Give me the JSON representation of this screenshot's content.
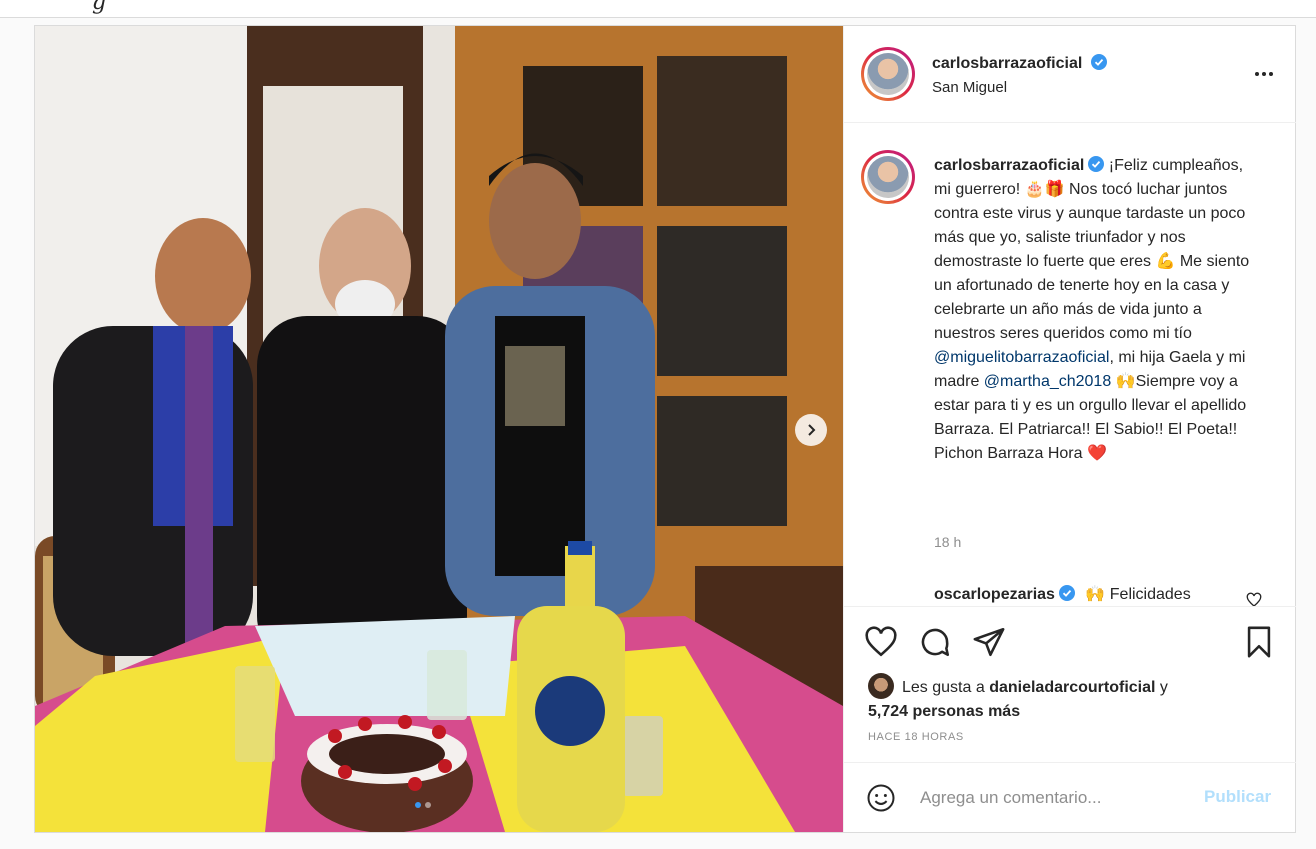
{
  "post": {
    "author": "carlosbarrazaoficial",
    "location": "San Miguel",
    "caption": {
      "part1": "¡Feliz cumpleaños, mi guerrero! 🎂🎁 Nos tocó luchar juntos contra este virus y aunque tardaste un poco más que yo, saliste triunfador y nos demostraste lo fuerte que eres 💪 Me siento un afortunado de tenerte hoy en la casa y celebrarte un año más de vida junto a nuestros seres queridos como mi tío ",
      "mention1": "@miguelitobarrazaoficial",
      "part2": ", mi hija Gaela y mi madre ",
      "mention2": "@martha_ch2018",
      "part3": " 🙌Siempre voy a estar para ti y es un orgullo llevar el apellido Barraza. El Patriarca!! El Sabio!! El Poeta!! Pichon Barraza Hora ❤️"
    },
    "caption_time": "18 h",
    "comment": {
      "user": "oscarlopezarias",
      "text": "🙌 Felicidades"
    },
    "likes": {
      "prefix": "Les gusta a",
      "liker": "danieladarcourtoficial",
      "connector": "y",
      "others": "5,724 personas más"
    },
    "time_ago": "HACE 18 HORAS",
    "comment_box": {
      "placeholder": "Agrega un comentario...",
      "publish": "Publicar"
    }
  },
  "colors": {
    "verified": "#3897f0",
    "mention": "#00376b",
    "publish_disabled": "#b2dffc"
  }
}
